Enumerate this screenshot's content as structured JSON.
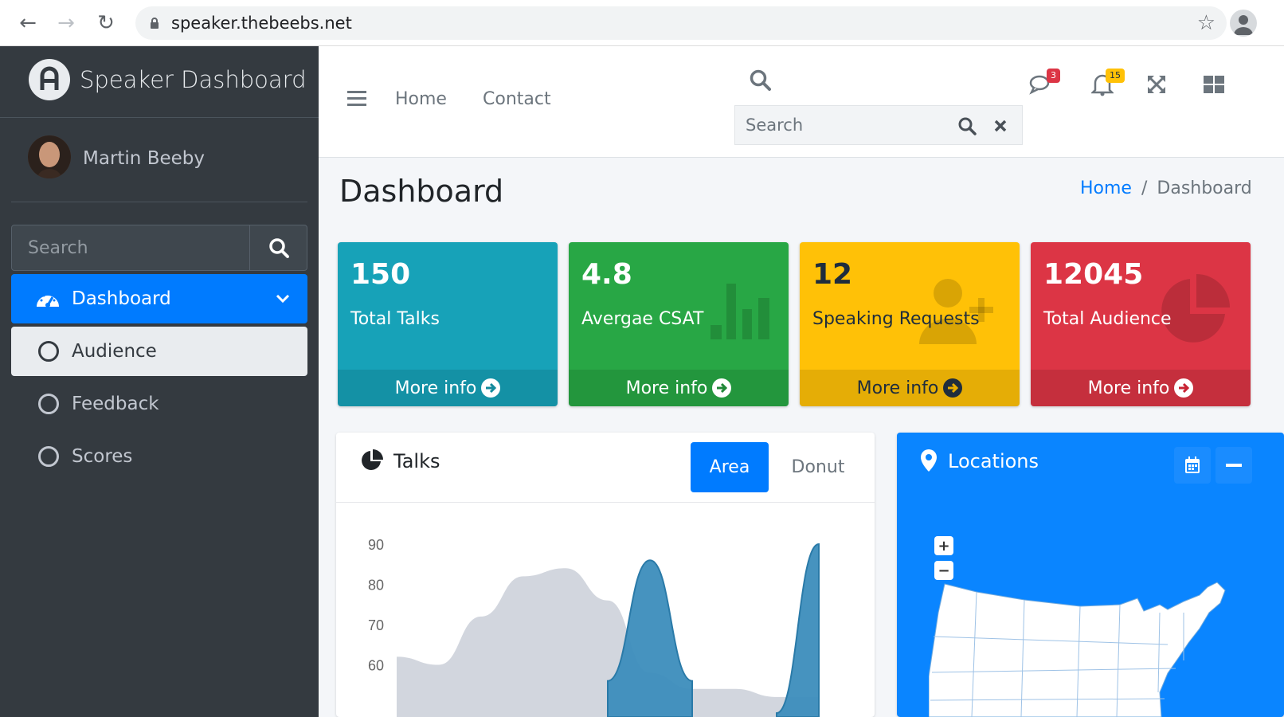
{
  "browser": {
    "url": "speaker.thebeebs.net"
  },
  "sidebar": {
    "brand": "Speaker Dashboard",
    "user_name": "Martin Beeby",
    "search_placeholder": "Search",
    "items": [
      {
        "label": "Dashboard",
        "state": "active"
      },
      {
        "label": "Audience",
        "state": "open"
      },
      {
        "label": "Feedback",
        "state": "plain"
      },
      {
        "label": "Scores",
        "state": "plain"
      }
    ]
  },
  "topbar": {
    "links": [
      "Home",
      "Contact"
    ],
    "search_placeholder": "Search",
    "messages_count": "3",
    "notifications_count": "15"
  },
  "page": {
    "title": "Dashboard",
    "breadcrumb_home": "Home",
    "breadcrumb_sep": "/",
    "breadcrumb_current": "Dashboard"
  },
  "stats": [
    {
      "value": "150",
      "label": "Total Talks",
      "footer": "More info",
      "color": "#17a2b8"
    },
    {
      "value": "4.8",
      "label": "Avergae CSAT",
      "footer": "More info",
      "color": "#28a745"
    },
    {
      "value": "12",
      "label": "Speaking Requests",
      "footer": "More info",
      "color": "#ffc107"
    },
    {
      "value": "12045",
      "label": "Total Audience",
      "footer": "More info",
      "color": "#dc3545"
    }
  ],
  "talks": {
    "title": "Talks",
    "tabs": [
      "Area",
      "Donut"
    ],
    "active_tab": "Area"
  },
  "locations": {
    "title": "Locations",
    "zoom_in": "+",
    "zoom_out": "−"
  },
  "chart_data": {
    "type": "area",
    "title": "",
    "xlabel": "",
    "ylabel": "",
    "y_ticks": [
      90,
      80,
      70,
      60
    ],
    "ylim": [
      55,
      95
    ],
    "series": [
      {
        "values": [
          62,
          60,
          72,
          82,
          84,
          76,
          58,
          54,
          54,
          52,
          52
        ]
      },
      {
        "values": [
          null,
          null,
          null,
          null,
          null,
          56,
          86,
          56,
          null,
          48,
          90
        ]
      }
    ]
  },
  "colors": {
    "sidebar": "#343a40",
    "primary": "#007bff",
    "locations": "#0a85ff",
    "series1": "#d2d6de",
    "series2": "#3c8dbc"
  }
}
